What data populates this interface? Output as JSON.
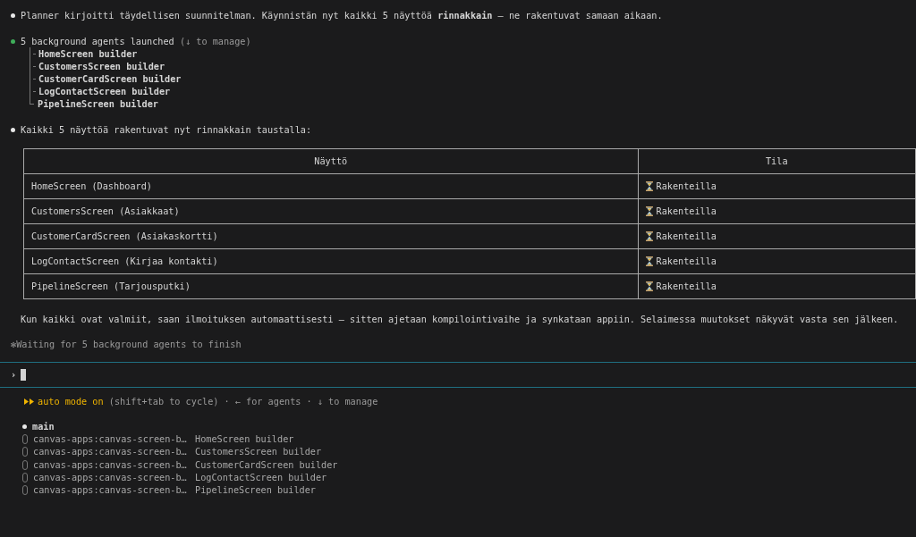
{
  "messages": [
    {
      "kind": "assistant",
      "text": "Planner kirjoitti täydellisen suunnitelman. Käynnistän nyt kaikki 5 näyttöä **rinnakkain** — ne rakentuvat samaan aikaan."
    }
  ],
  "agents": {
    "title": "5 background agents launched",
    "hint": "(↓ to manage)",
    "items": [
      "HomeScreen builder",
      "CustomersScreen builder",
      "CustomerCardScreen builder",
      "LogContactScreen builder",
      "PipelineScreen builder"
    ]
  },
  "summary": "Kaikki 5 näyttöä rakentuvat nyt rinnakkain taustalla:",
  "table": {
    "columns": [
      "Näyttö",
      "Tila"
    ],
    "rows": [
      {
        "screen": "HomeScreen (Dashboard)",
        "status": "Rakenteilla"
      },
      {
        "screen": "CustomersScreen (Asiakkaat)",
        "status": "Rakenteilla"
      },
      {
        "screen": "CustomerCardScreen (Asiakaskortti)",
        "status": "Rakenteilla"
      },
      {
        "screen": "LogContactScreen (Kirjaa kontakti)",
        "status": "Rakenteilla"
      },
      {
        "screen": "PipelineScreen (Tarjousputki)",
        "status": "Rakenteilla"
      }
    ]
  },
  "note": "Kun kaikki ovat valmiit, saan ilmoituksen automaattisesti — sitten ajetaan kompilointivaihe ja synkataan appiin. Selaimessa muutokset näkyvät vasta sen jälkeen.",
  "waiting": {
    "symbol": "✻",
    "text": "Waiting for 5 background agents to finish"
  },
  "prompt": {
    "symbol": "›"
  },
  "mode": {
    "label": "auto mode on",
    "hint": "(shift+tab to cycle) · ← for agents · ↓ to manage"
  },
  "sessions": [
    {
      "kind": "main",
      "name": "main"
    },
    {
      "kind": "agent",
      "name": "canvas-apps:canvas-screen-b…",
      "task": "HomeScreen builder"
    },
    {
      "kind": "agent",
      "name": "canvas-apps:canvas-screen-b…",
      "task": "CustomersScreen builder"
    },
    {
      "kind": "agent",
      "name": "canvas-apps:canvas-screen-b…",
      "task": "CustomerCardScreen builder"
    },
    {
      "kind": "agent",
      "name": "canvas-apps:canvas-screen-b…",
      "task": "LogContactScreen builder"
    },
    {
      "kind": "agent",
      "name": "canvas-apps:canvas-screen-b…",
      "task": "PipelineScreen builder"
    }
  ]
}
